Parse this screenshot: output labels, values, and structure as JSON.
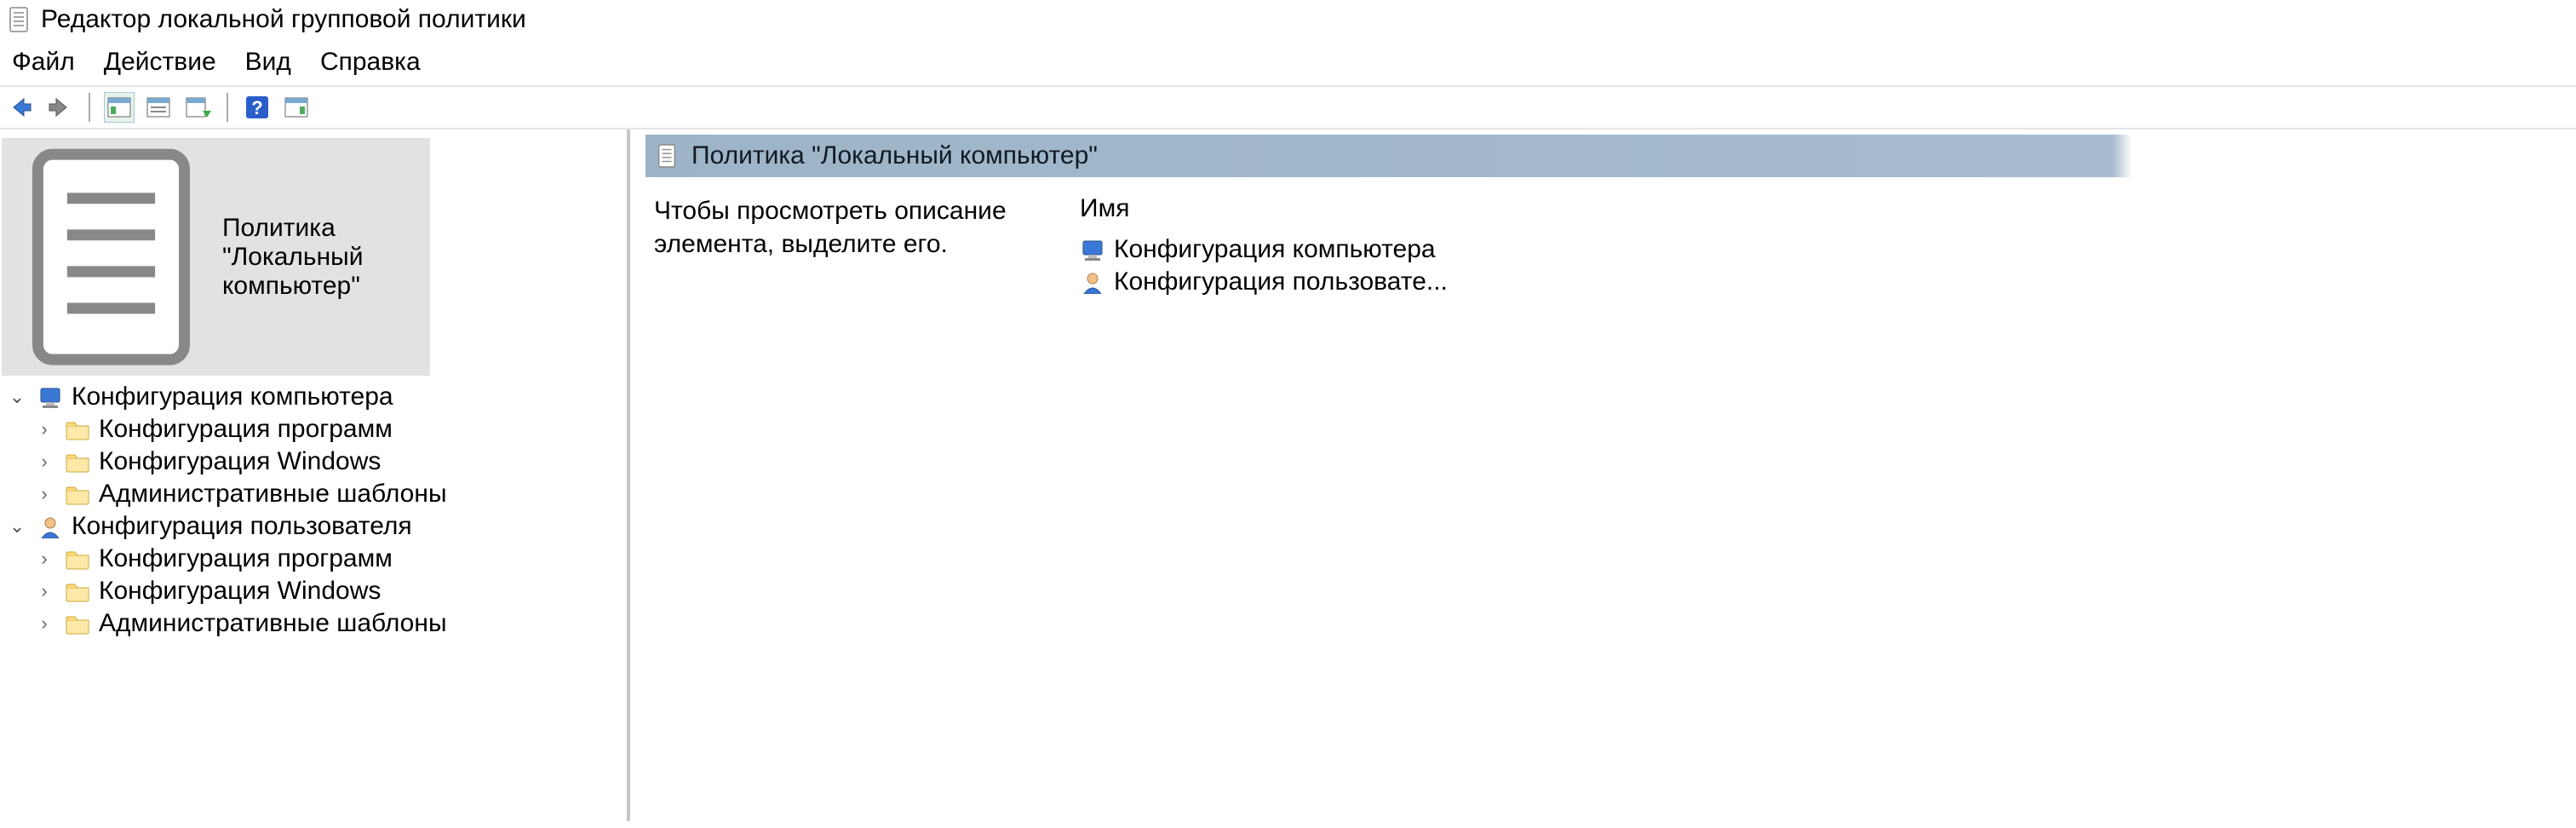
{
  "title": "Редактор локальной групповой политики",
  "menu": {
    "file": "Файл",
    "action": "Действие",
    "view": "Вид",
    "help": "Справка"
  },
  "tree": {
    "root": "Политика \"Локальный компьютер\"",
    "computer": {
      "label": "Конфигурация компьютера",
      "children": [
        "Конфигурация программ",
        "Конфигурация Windows",
        "Административные шаблоны"
      ]
    },
    "user": {
      "label": "Конфигурация пользователя",
      "children": [
        "Конфигурация программ",
        "Конфигурация Windows",
        "Административные шаблоны"
      ]
    }
  },
  "right": {
    "header": "Политика \"Локальный компьютер\"",
    "desc": "Чтобы просмотреть описание элемента, выделите его.",
    "colheader": "Имя",
    "items": [
      "Конфигурация компьютера",
      "Конфигурация пользовате..."
    ]
  }
}
